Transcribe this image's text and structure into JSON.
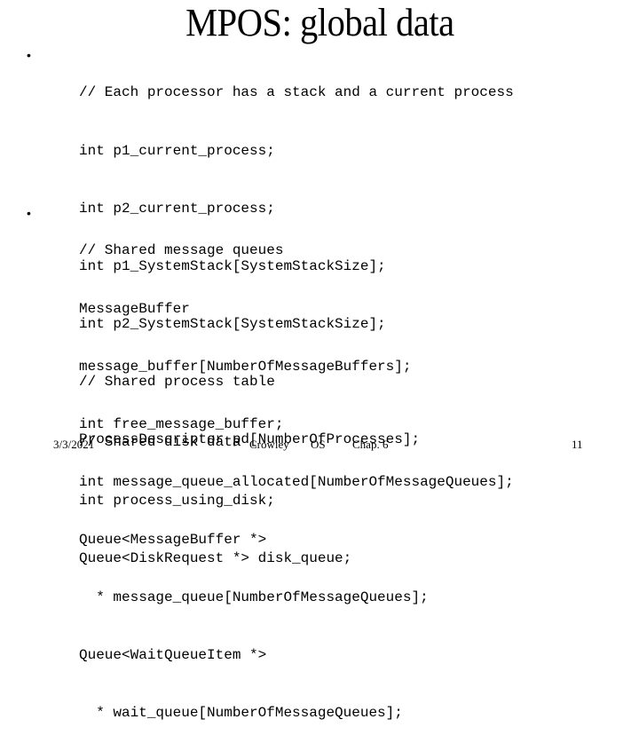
{
  "title": "MPOS: global data",
  "sections": [
    {
      "bullet": "•",
      "lines": [
        "// Each processor has a stack and a current process",
        "int p1_current_process;",
        "int p2_current_process;",
        "int p1_SystemStack[SystemStackSize];",
        "int p2_SystemStack[SystemStackSize];",
        "// Shared process table",
        "ProcessDescriptor pd[NumberOfProcesses];"
      ]
    },
    {
      "bullet": "•",
      "lines": [
        "// Shared message queues",
        "MessageBuffer",
        "message_buffer[NumberOfMessageBuffers];",
        "int free_message_buffer;",
        "int message_queue_allocated[NumberOfMessageQueues];",
        "Queue<MessageBuffer *>",
        "  * message_queue[NumberOfMessageQueues];",
        "Queue<WaitQueueItem *>",
        "  * wait_queue[NumberOfMessageQueues];"
      ]
    },
    {
      "lines": [
        "// Shared disk data",
        "int process_using_disk;",
        "Queue<DiskRequest *> disk_queue;"
      ]
    }
  ],
  "footer": {
    "date": "3/3/2021",
    "author": "Crowley",
    "course": "OS",
    "chapter": "Chap. 6",
    "page": "11"
  }
}
